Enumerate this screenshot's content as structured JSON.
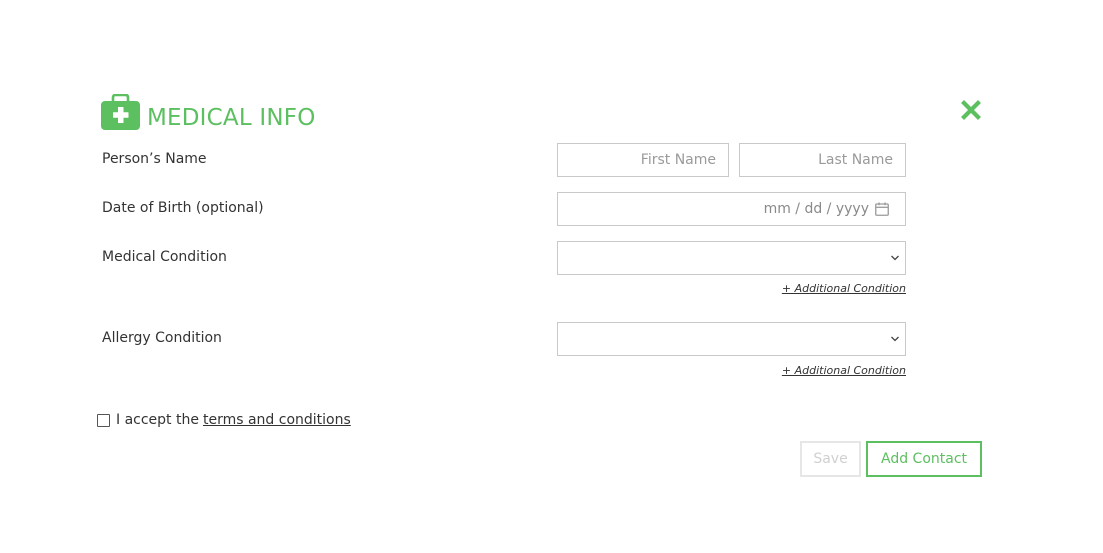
{
  "header": {
    "title": "MEDICAL INFO",
    "icon": "first-aid-kit-icon",
    "close_icon": "close-icon"
  },
  "form": {
    "name_label": "Person’s Name",
    "first_name_placeholder": "First Name",
    "last_name_placeholder": "Last Name",
    "dob_label": "Date of Birth (optional)",
    "dob_placeholder": "mm / dd / yyyy",
    "medical_label": "Medical Condition",
    "medical_value": "",
    "add_medical_link": "+ Additional Condition",
    "allergy_label": "Allergy Condition",
    "allergy_value": "",
    "add_allergy_link": "+ Additional Condition"
  },
  "terms": {
    "prefix": "I accept the",
    "link": "terms and conditions",
    "checked": false
  },
  "buttons": {
    "save": "Save",
    "add_contact": "Add Contact"
  },
  "colors": {
    "accent": "#5cbf60",
    "text": "#333333",
    "border": "#c9c9c9",
    "disabled": "#d0d0d0"
  }
}
